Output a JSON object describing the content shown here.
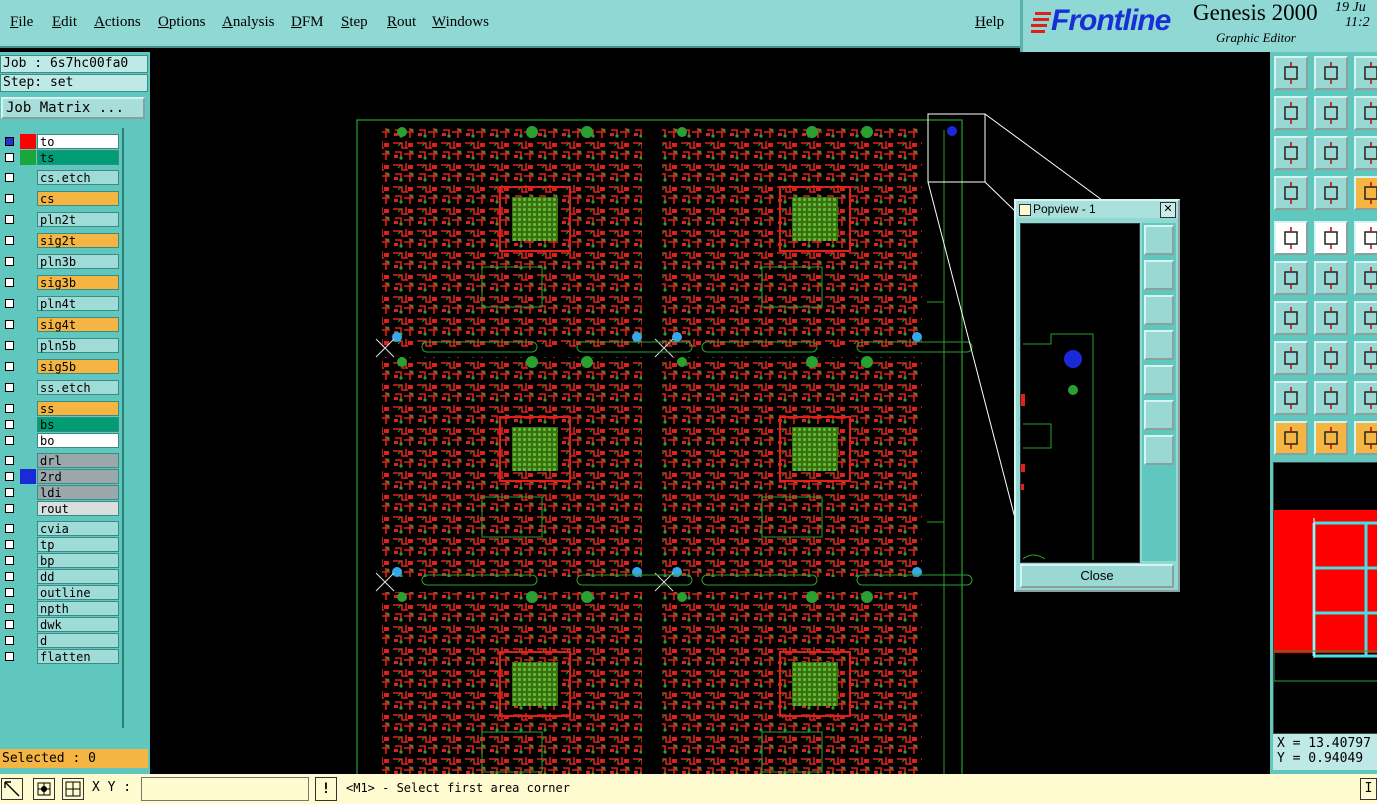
{
  "menu": {
    "file": "File",
    "edit": "Edit",
    "actions": "Actions",
    "options": "Options",
    "analysis": "Analysis",
    "dfm": "DFM",
    "step": "Step",
    "rout": "Rout",
    "windows": "Windows",
    "help": "Help"
  },
  "branding": {
    "logo": "Frontline",
    "app_title": "Genesis 2000",
    "app_subtitle": "Graphic Editor",
    "date": "19 Ju",
    "time": "11:2"
  },
  "job_info": {
    "job": "Job : 6s7hc00fa0",
    "step": "Step: set",
    "job_matrix": "Job Matrix ..."
  },
  "layers": [
    {
      "name": "to",
      "color": "#ffffff",
      "swatch": "#ff0000",
      "checked": true
    },
    {
      "name": "ts",
      "color": "#009c74",
      "swatch": "#1aa63c",
      "checked": false
    },
    {
      "name": "cs.etch",
      "color": "#9fdcd7",
      "swatch": "",
      "checked": false
    },
    {
      "name": "cs",
      "color": "#f5b543",
      "swatch": "",
      "checked": false
    },
    {
      "name": "pln2t",
      "color": "#9fdcd7",
      "swatch": "",
      "checked": false
    },
    {
      "name": "sig2t",
      "color": "#f5b543",
      "swatch": "",
      "checked": false
    },
    {
      "name": "pln3b",
      "color": "#9fdcd7",
      "swatch": "",
      "checked": false
    },
    {
      "name": "sig3b",
      "color": "#f5b543",
      "swatch": "",
      "checked": false
    },
    {
      "name": "pln4t",
      "color": "#9fdcd7",
      "swatch": "",
      "checked": false
    },
    {
      "name": "sig4t",
      "color": "#f5b543",
      "swatch": "",
      "checked": false
    },
    {
      "name": "pln5b",
      "color": "#9fdcd7",
      "swatch": "",
      "checked": false
    },
    {
      "name": "sig5b",
      "color": "#f5b543",
      "swatch": "",
      "checked": false
    },
    {
      "name": "ss.etch",
      "color": "#9fdcd7",
      "swatch": "",
      "checked": false
    },
    {
      "name": "ss",
      "color": "#f5b543",
      "swatch": "",
      "checked": false
    },
    {
      "name": "bs",
      "color": "#009c74",
      "swatch": "",
      "checked": false
    },
    {
      "name": "bo",
      "color": "#ffffff",
      "swatch": "",
      "checked": false
    },
    {
      "name": "drl",
      "color": "#9aa8ac",
      "swatch": "",
      "checked": false
    },
    {
      "name": "2rd",
      "color": "#9aa8ac",
      "swatch": "#1b2ad8",
      "checked": false
    },
    {
      "name": "ldi",
      "color": "#9aa8ac",
      "swatch": "",
      "checked": false
    },
    {
      "name": "rout",
      "color": "#d9dede",
      "swatch": "",
      "checked": false
    },
    {
      "name": "cvia",
      "color": "#9fdcd7",
      "swatch": "",
      "checked": false
    },
    {
      "name": "tp",
      "color": "#9fdcd7",
      "swatch": "",
      "checked": false
    },
    {
      "name": "bp",
      "color": "#9fdcd7",
      "swatch": "",
      "checked": false
    },
    {
      "name": "dd",
      "color": "#9fdcd7",
      "swatch": "",
      "checked": false
    },
    {
      "name": "outline",
      "color": "#9fdcd7",
      "swatch": "",
      "checked": false
    },
    {
      "name": "npth",
      "color": "#9fdcd7",
      "swatch": "",
      "checked": false
    },
    {
      "name": "dwk",
      "color": "#9fdcd7",
      "swatch": "",
      "checked": false
    },
    {
      "name": "d",
      "color": "#9fdcd7",
      "swatch": "",
      "checked": false
    },
    {
      "name": "flatten",
      "color": "#9fdcd7",
      "swatch": "",
      "checked": false
    }
  ],
  "selected": "Selected : 0",
  "popview": {
    "title": "Popview - 1",
    "close_label": "Close"
  },
  "coords": {
    "x": "X = 13.40797",
    "y": "Y = 0.94049"
  },
  "status": {
    "xy_label": "X Y :",
    "xy_value": "",
    "message": "<M1> - Select first area corner",
    "right_btn": "I"
  },
  "colors": {
    "panel": "#5fc7bd",
    "menu": "#8fd8d4",
    "copper_red": "#e0201a",
    "silk_green": "#2aa030",
    "drill_blue": "#35a8e8",
    "accent_orange": "#f5b543"
  }
}
